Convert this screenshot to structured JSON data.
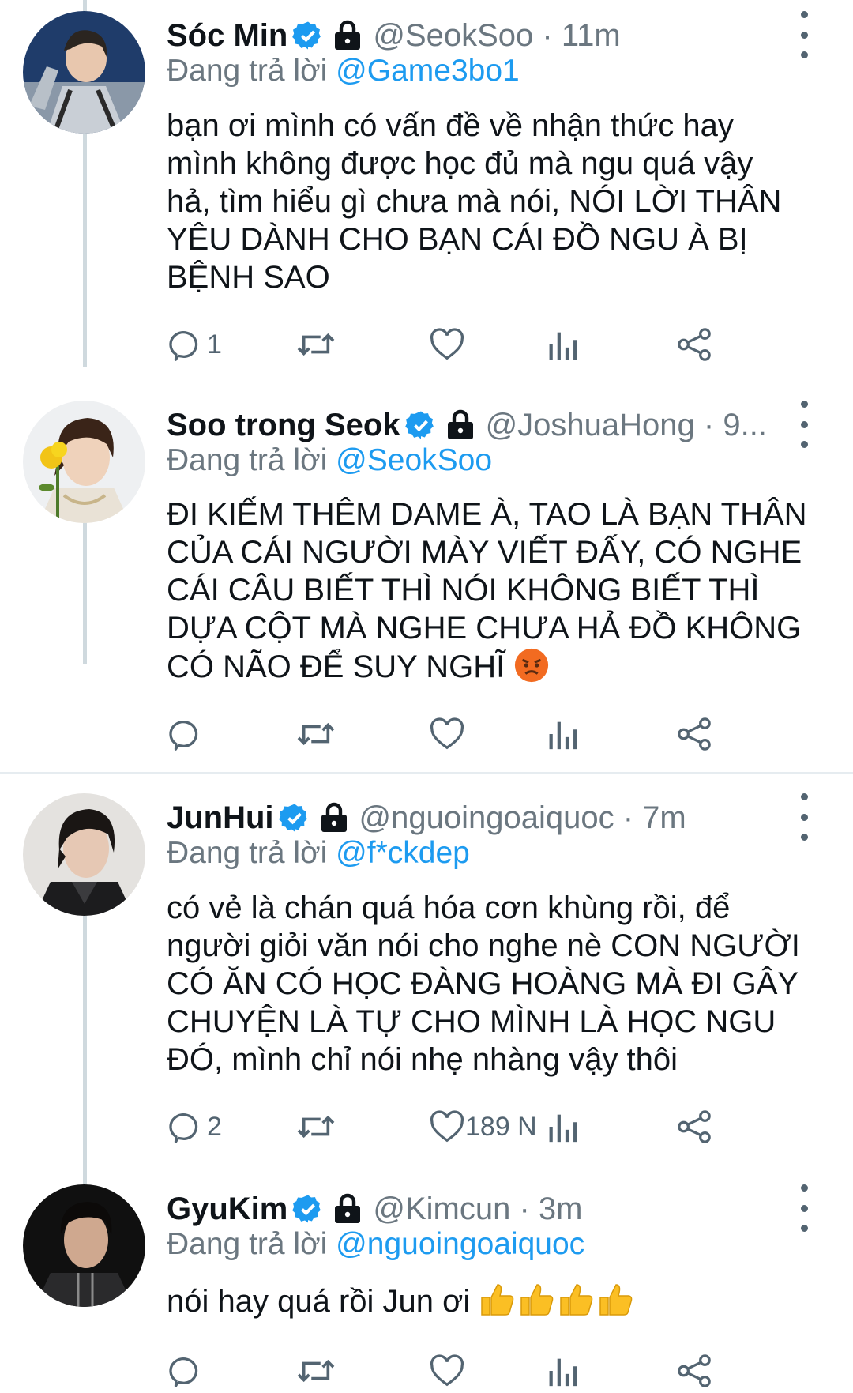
{
  "tweets": [
    {
      "name": "Sóc Min",
      "handle": "@SeokSoo · 11m",
      "replying_prefix": "Đang trả lời ",
      "replying_to": "@Game3bo1",
      "text": "bạn ơi mình có vấn đề về nhận thức hay\nmình không được học đủ mà ngu quá vậy\nhả, tìm hiểu gì chưa mà nói, NÓI LỜI THÂN\nYÊU DÀNH CHO BẠN CÁI ĐỒ NGU À BỊ\nBỆNH SAO",
      "reply_count": "1",
      "retweet_count": "",
      "like_count": ""
    },
    {
      "name": "Soo trong Seok",
      "handle": "@JoshuaHong · 9...",
      "replying_prefix": "Đang trả lời ",
      "replying_to": "@SeokSoo",
      "text": "ĐI KIẾM THÊM DAME À, TAO LÀ BẠN THÂN\nCỦA CÁI NGƯỜI MÀY VIẾT ĐẤY, CÓ NGHE\nCÁI CÂU BIẾT THÌ NÓI KHÔNG BIẾT THÌ\nDỰA CỘT MÀ NGHE CHƯA HẢ ĐỒ KHÔNG\nCÓ NÃO ĐỂ SUY NGHĨ",
      "reply_count": "",
      "retweet_count": "",
      "like_count": ""
    },
    {
      "name": "JunHui",
      "handle": "@nguoingoaiquoc · 7m",
      "replying_prefix": "Đang trả lời ",
      "replying_to": "@f*ckdep",
      "text": "có vẻ là chán quá hóa cơn khùng rồi, để\nngười giỏi văn nói cho nghe nè CON NGƯỜI\nCÓ ĂN CÓ HỌC ĐÀNG HOÀNG MÀ ĐI GÂY\nCHUYỆN LÀ TỰ CHO MÌNH LÀ HỌC NGU\nĐÓ, mình chỉ nói nhẹ nhàng vậy thôi",
      "reply_count": "2",
      "retweet_count": "",
      "like_count": "189 N"
    },
    {
      "name": "GyuKim",
      "handle": "@Kimcun · 3m",
      "replying_prefix": "Đang trả lời ",
      "replying_to": "@nguoingoaiquoc",
      "text": "nói hay quá rồi Jun ơi ",
      "reply_count": "",
      "retweet_count": "",
      "like_count": ""
    }
  ],
  "colors": {
    "verified": "#1d9bf0",
    "mention": "#1d9bf0",
    "secondary_text": "#6b7780",
    "icon": "#536471",
    "thread_line": "#cfd9de"
  },
  "icons": [
    "reply-icon",
    "retweet-icon",
    "like-icon",
    "analytics-icon",
    "share-icon",
    "verified-icon",
    "lock-icon",
    "more-icon",
    "angry-emoji",
    "thumbs-up-emoji"
  ]
}
